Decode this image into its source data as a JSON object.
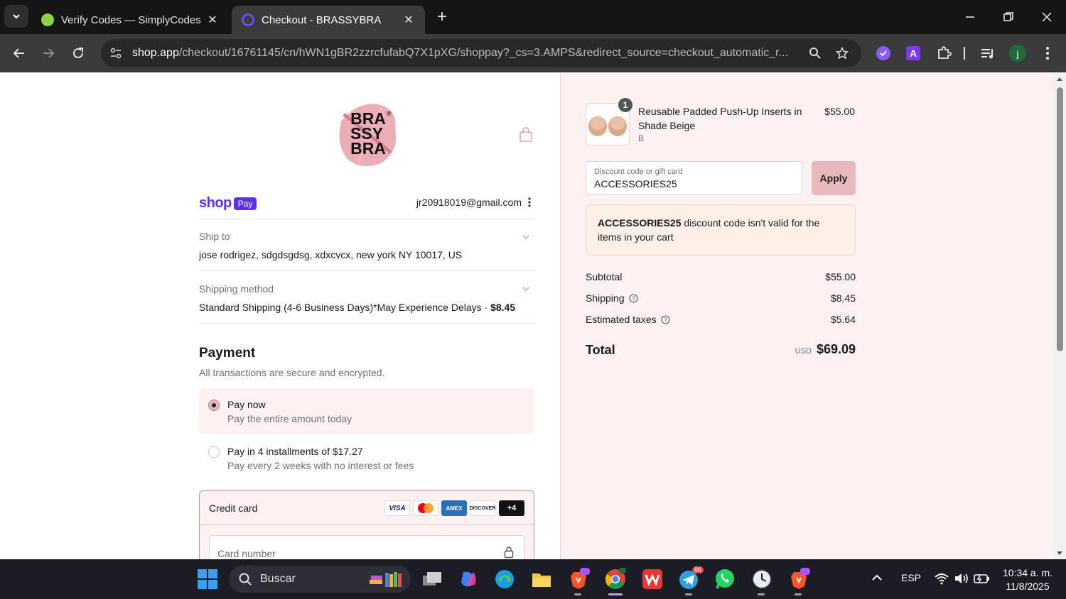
{
  "browser": {
    "tabs": [
      {
        "title": "Verify Codes — SimplyCodes",
        "active": false
      },
      {
        "title": "Checkout - BRASSYBRA",
        "active": true
      }
    ],
    "url_host": "shop.app",
    "url_path": "/checkout/16761145/cn/hWN1gBR2zzrcfufabQ7X1pXG/shoppay?_cs=3.AMPS&redirect_source=checkout_automatic_r...",
    "profile_initial": "j",
    "colors": {
      "tabbar": "#151515",
      "toolbar": "#3b3b3b",
      "omnibox": "#282828"
    }
  },
  "checkout": {
    "brand": {
      "logo_lines": [
        "BRA",
        "SSY",
        "BRA"
      ],
      "registered": "®"
    },
    "shoppay": {
      "shop": "shop",
      "pay": "Pay"
    },
    "email": "jr20918019@gmail.com",
    "ship_to": {
      "label": "Ship to",
      "value": "jose rodrigez, sdgdsgdsg, xdxcvcx, new york NY 10017, US"
    },
    "shipping_method": {
      "label": "Shipping method",
      "value": "Standard Shipping (4-6 Business Days)*May Experience Delays · ",
      "price": "$8.45"
    },
    "payment": {
      "title": "Payment",
      "subtitle": "All transactions are secure and encrypted.",
      "options": [
        {
          "title": "Pay now",
          "subtitle": "Pay the entire amount today",
          "selected": true
        },
        {
          "title": "Pay in 4 installments of $17.27",
          "subtitle": "Pay every 2 weeks with no interest or fees",
          "selected": false
        }
      ],
      "credit_card": {
        "label": "Credit card",
        "brands": [
          "VISA",
          "AMEX",
          "DISCOVER"
        ],
        "more": "+4",
        "card_number_placeholder": "Card number"
      }
    },
    "colors": {
      "accent": "#e7b9bd",
      "shoppay": "#5a31f4",
      "summary_bg": "#fdf1f1"
    }
  },
  "summary": {
    "item": {
      "quantity": "1",
      "name": "Reusable Padded Push-Up Inserts in Shade Beige",
      "variant": "B",
      "price": "$55.00"
    },
    "discount": {
      "label": "Discount code or gift card",
      "value": "ACCESSORIES25",
      "apply": "Apply"
    },
    "error": {
      "code": "ACCESSORIES25",
      "message": " discount code isn't valid for the items in your cart"
    },
    "subtotal": {
      "label": "Subtotal",
      "value": "$55.00"
    },
    "shipping": {
      "label": "Shipping",
      "value": "$8.45"
    },
    "taxes": {
      "label": "Estimated taxes",
      "value": "$5.64"
    },
    "total": {
      "label": "Total",
      "currency": "USD",
      "value": "$69.09"
    }
  },
  "taskbar": {
    "search_placeholder": "Buscar",
    "language": "ESP",
    "time": "10:34 a. m.",
    "date": "11/8/2025",
    "telegram_badge": "86"
  }
}
